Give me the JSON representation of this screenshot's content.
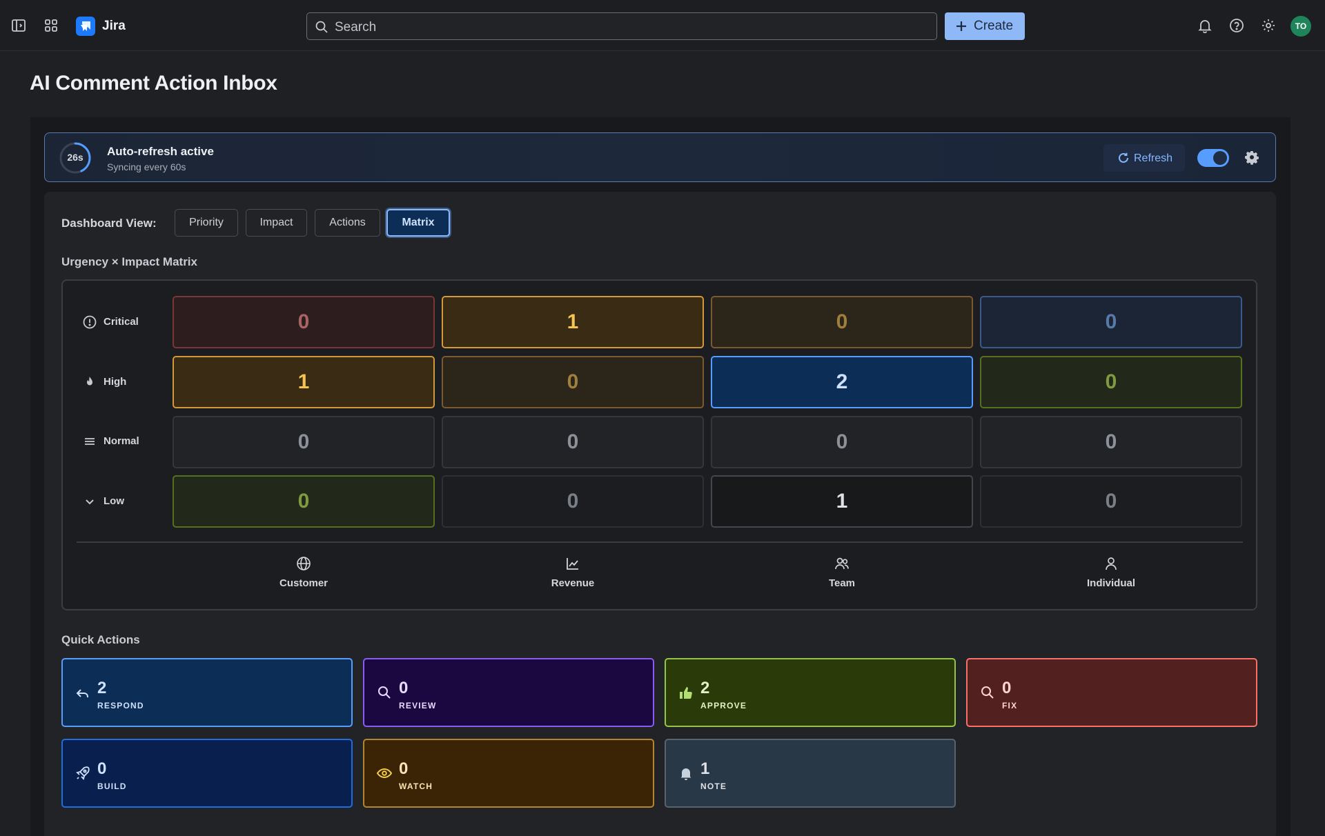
{
  "topbar": {
    "brand": "Jira",
    "search_placeholder": "Search",
    "create_label": "Create",
    "avatar_initials": "TO"
  },
  "page": {
    "title": "AI Comment Action Inbox"
  },
  "refresh": {
    "countdown": "26s",
    "countdown_fraction": 0.43,
    "title": "Auto-refresh active",
    "subtitle": "Syncing every 60s",
    "button_label": "Refresh",
    "toggle_on": true
  },
  "dashboard": {
    "label": "Dashboard View:",
    "views": [
      "Priority",
      "Impact",
      "Actions",
      "Matrix"
    ],
    "active_view": "Matrix"
  },
  "matrix": {
    "title": "Urgency × Impact Matrix",
    "rows": [
      {
        "label": "Critical",
        "icon": "alert-circle-icon"
      },
      {
        "label": "High",
        "icon": "flame-icon"
      },
      {
        "label": "Normal",
        "icon": "menu-lines-icon"
      },
      {
        "label": "Low",
        "icon": "chevron-down-icon"
      }
    ],
    "columns": [
      {
        "label": "Customer",
        "icon": "globe-icon"
      },
      {
        "label": "Revenue",
        "icon": "line-chart-icon"
      },
      {
        "label": "Team",
        "icon": "users-icon"
      },
      {
        "label": "Individual",
        "icon": "user-icon"
      }
    ],
    "values": [
      [
        "0",
        "1",
        "0",
        "0"
      ],
      [
        "1",
        "0",
        "2",
        "0"
      ],
      [
        "0",
        "0",
        "0",
        "0"
      ],
      [
        "0",
        "0",
        "1",
        "0"
      ]
    ]
  },
  "quick_actions": {
    "title": "Quick Actions",
    "items": [
      {
        "count": "2",
        "label": "RESPOND",
        "icon": "reply-icon"
      },
      {
        "count": "0",
        "label": "REVIEW",
        "icon": "search-icon"
      },
      {
        "count": "2",
        "label": "APPROVE",
        "icon": "thumbs-up-icon"
      },
      {
        "count": "0",
        "label": "FIX",
        "icon": "search-icon"
      },
      {
        "count": "0",
        "label": "BUILD",
        "icon": "rocket-icon"
      },
      {
        "count": "0",
        "label": "WATCH",
        "icon": "eye-icon"
      },
      {
        "count": "1",
        "label": "NOTE",
        "icon": "bell-icon"
      }
    ]
  },
  "colors": {
    "accent": "#579dff",
    "create_button": "#8fb8f6",
    "avatar": "#1f845a"
  }
}
